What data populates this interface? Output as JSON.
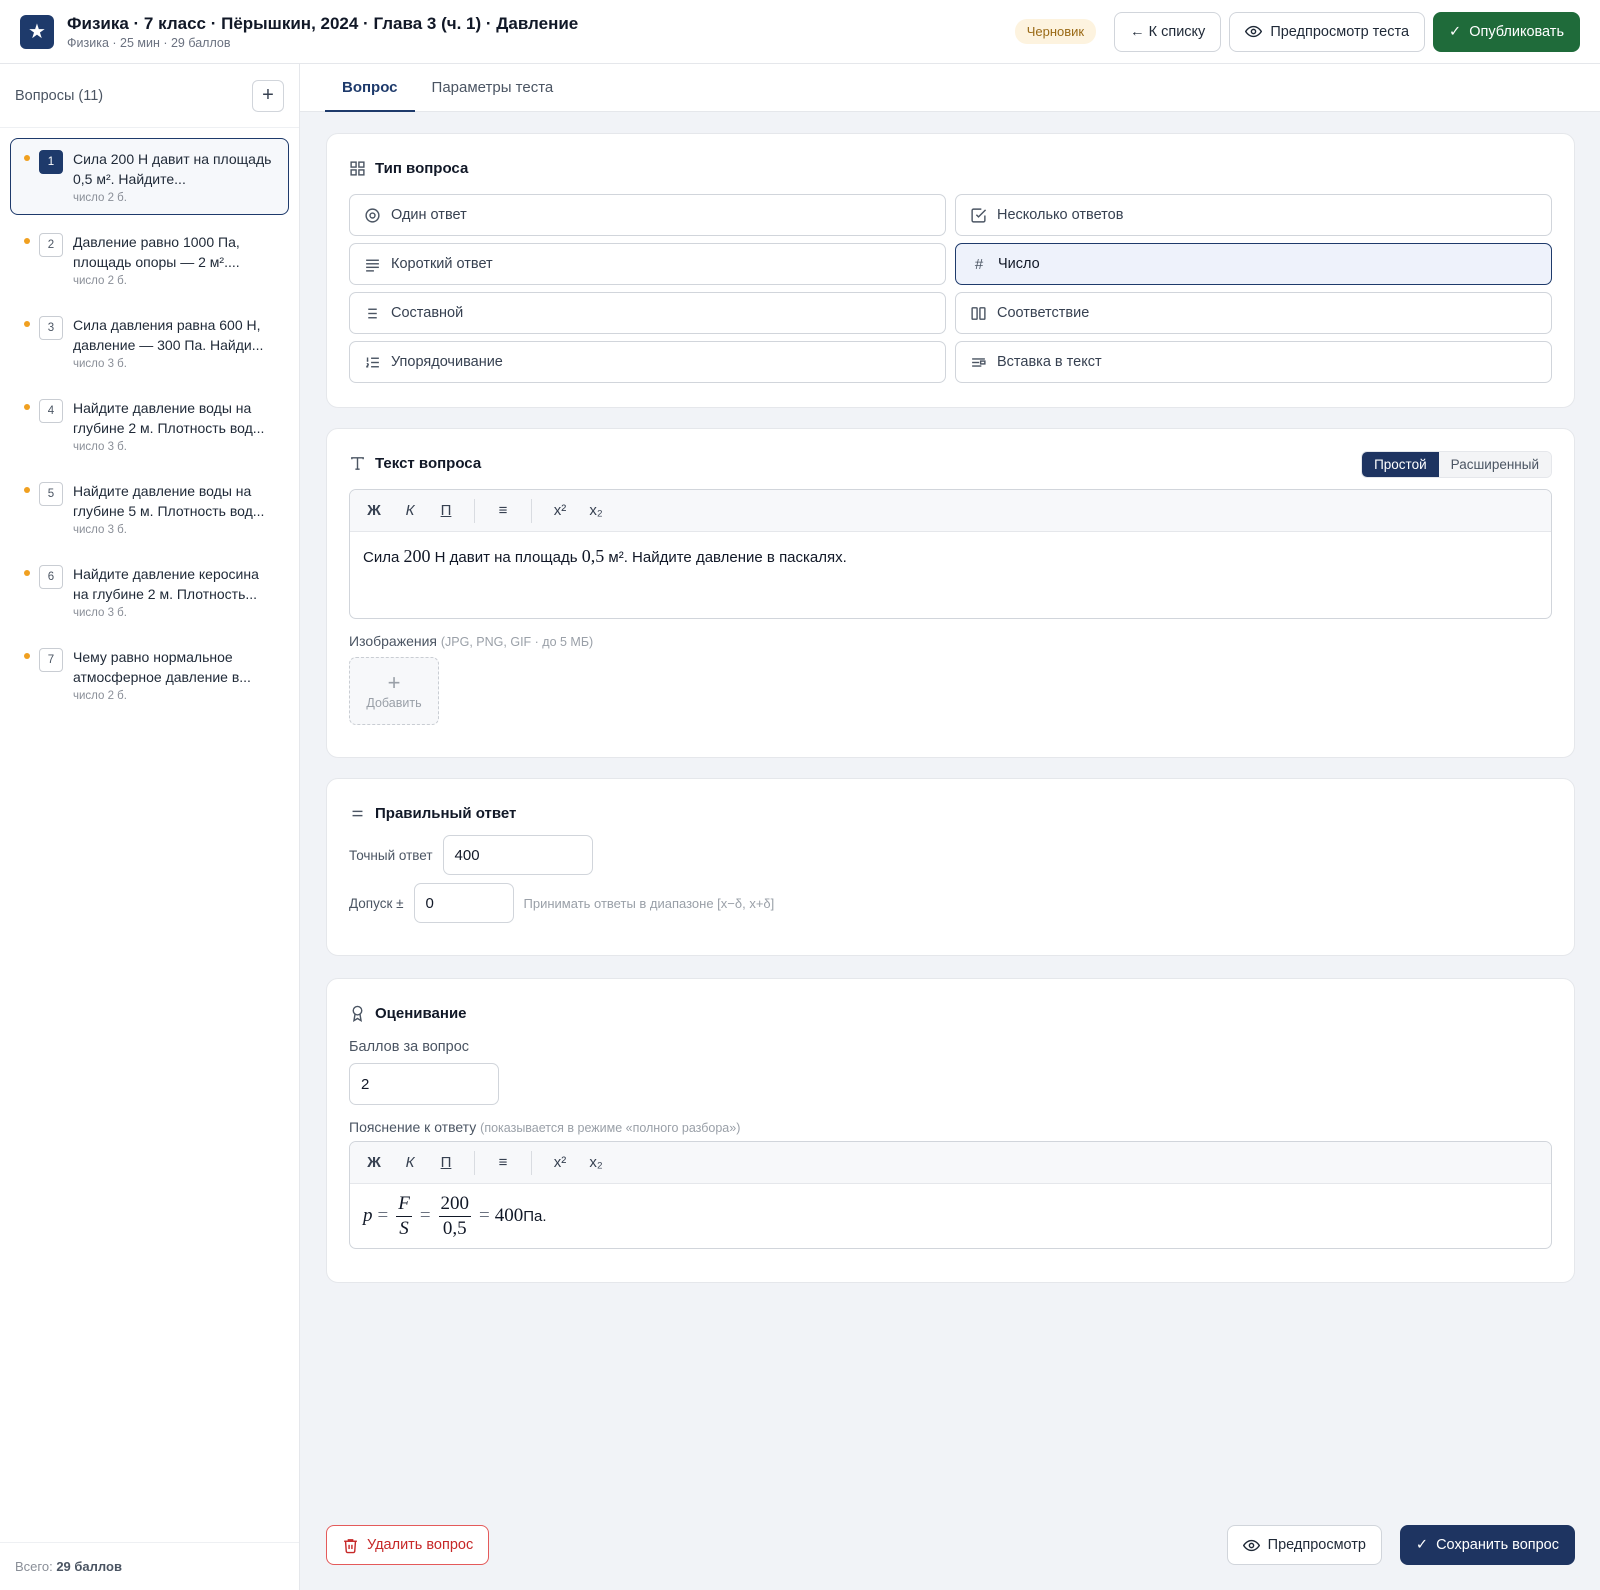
{
  "header": {
    "title": "Физика · 7 класс · Пёрышкин, 2024 · Глава 3 (ч. 1) · Давление",
    "subtitle": "Физика · 25 мин · 29 баллов",
    "status_badge": "Черновик",
    "back_button": "← К списку",
    "preview_test_button": "Предпросмотр теста",
    "publish_button": "Опубликовать"
  },
  "sidebar": {
    "heading": "Вопросы (11)",
    "items": [
      {
        "num": "1",
        "text": "Сила 200 Н давит на площадь 0,5 м². Найдите...",
        "meta": "число  2 б."
      },
      {
        "num": "2",
        "text": "Давление равно 1000 Па, площадь опоры — 2 м²....",
        "meta": "число  2 б."
      },
      {
        "num": "3",
        "text": "Сила давления равна 600 Н, давление — 300 Па. Найди...",
        "meta": "число  3 б."
      },
      {
        "num": "4",
        "text": "Найдите давление воды на глубине 2 м. Плотность вод...",
        "meta": "число  3 б."
      },
      {
        "num": "5",
        "text": "Найдите давление воды на глубине 5 м. Плотность вод...",
        "meta": "число  3 б."
      },
      {
        "num": "6",
        "text": "Найдите давление керосина на глубине 2 м. Плотность...",
        "meta": "число  3 б."
      },
      {
        "num": "7",
        "text": "Чему равно нормальное атмосферное давление в...",
        "meta": "число  2 б."
      }
    ],
    "footer_prefix": "Всего:",
    "footer_total": "29 баллов"
  },
  "tabs": [
    "Вопрос",
    "Параметры теста"
  ],
  "question_type": {
    "title": "Тип вопроса",
    "options": [
      {
        "label": "Один ответ",
        "icon": "radio-icon"
      },
      {
        "label": "Несколько ответов",
        "icon": "checkbox-icon"
      },
      {
        "label": "Короткий ответ",
        "icon": "short-text-icon"
      },
      {
        "label": "Число",
        "icon": "hash-icon"
      },
      {
        "label": "Составной",
        "icon": "list-icon"
      },
      {
        "label": "Соответствие",
        "icon": "columns-icon"
      },
      {
        "label": "Упорядочивание",
        "icon": "ordered-list-icon"
      },
      {
        "label": "Вставка в текст",
        "icon": "text-insert-icon"
      }
    ],
    "selected": "Число"
  },
  "question_text": {
    "title": "Текст вопроса",
    "mode_simple": "Простой",
    "mode_advanced": "Расширенный",
    "toolbar": [
      "Ж",
      "К",
      "П",
      "≡",
      "x²",
      "x₂"
    ],
    "text_a": "Сила ",
    "text_f": "200",
    "text_b": " Н давит на площадь ",
    "text_s": "0,5",
    "text_c": " м². Найдите давление в паскалях.",
    "images_label": "Изображения",
    "images_hint": "(JPG, PNG, GIF · до 5 МБ)",
    "add_image": "Добавить"
  },
  "correct_answer": {
    "title": "Правильный ответ",
    "exact_label": "Точный ответ",
    "exact_value": "400",
    "tolerance_label": "Допуск ±",
    "tolerance_value": "0",
    "tolerance_hint": "Принимать ответы в диапазоне [x−δ, x+δ]"
  },
  "grading": {
    "title": "Оценивание",
    "points_label": "Баллов за вопрос",
    "points_value": "2",
    "explanation_label": "Пояснение к ответу",
    "explanation_hint": "(показывается в режиме «полного разбора»)",
    "formula": {
      "p": "p",
      "eq": "=",
      "F": "F",
      "S": "S",
      "num": "200",
      "den": "0,5",
      "result": "400",
      "unit": " Па."
    }
  },
  "footer_actions": {
    "delete": "Удалить вопрос",
    "preview": "Предпросмотр",
    "save": "Сохранить вопрос"
  },
  "colors": {
    "accent": "#1e3a6b",
    "publish": "#1f6b3a",
    "danger": "#c62828",
    "draft": "#9a6a16"
  }
}
